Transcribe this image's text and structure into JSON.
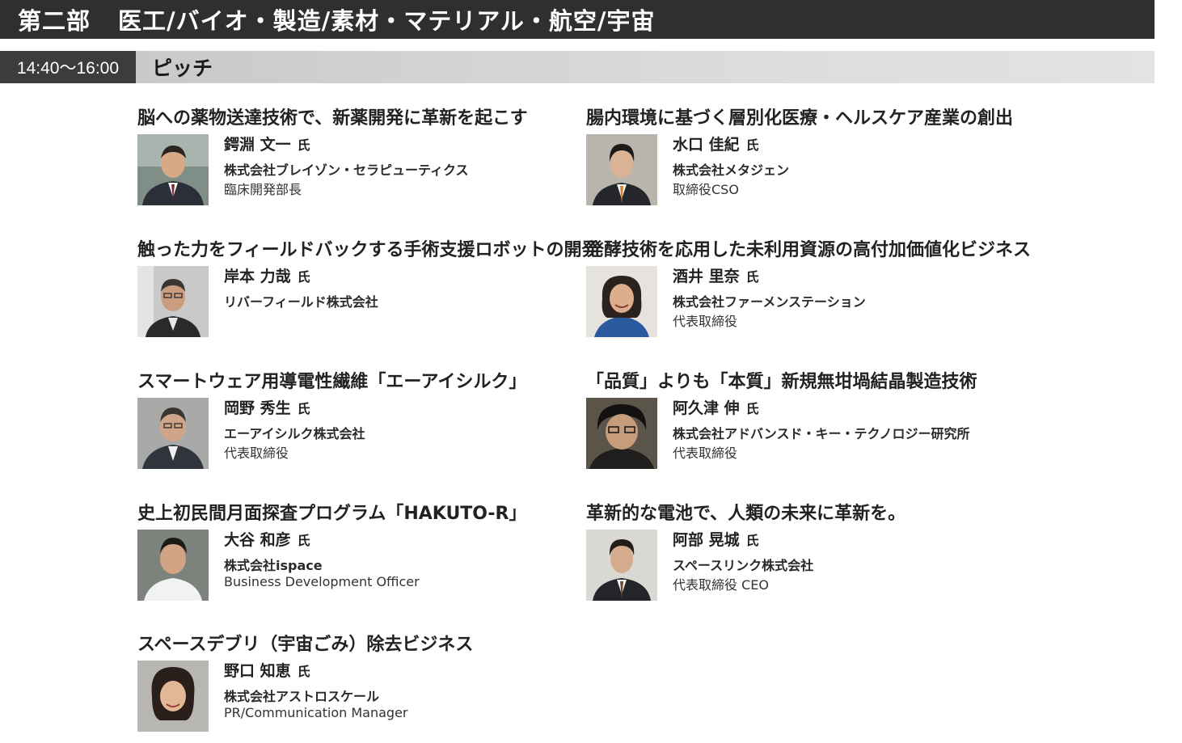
{
  "header": {
    "part": "第二部",
    "title": "医工/バイオ・製造/素材・マテリアル・航空/宇宙"
  },
  "session": {
    "time": "14:40〜16:00",
    "label": "ピッチ"
  },
  "honorific": "氏",
  "talks": [
    {
      "title": "脳への薬物送達技術で、新薬開発に革新を起こす",
      "speaker": "鍔淵 文一",
      "organization": "株式会社ブレイゾン・セラピューティクス",
      "role": "臨床開発部長"
    },
    {
      "title": "腸内環境に基づく層別化医療・ヘルスケア産業の創出",
      "speaker": "水口 佳紀",
      "organization": "株式会社メタジェン",
      "role": "取締役CSO"
    },
    {
      "title": "触った力をフィールドバックする手術支援ロボットの開発",
      "speaker": "岸本 力哉",
      "organization": "リバーフィールド株式会社",
      "role": ""
    },
    {
      "title": "発酵技術を応用した未利用資源の高付加価値化ビジネス",
      "speaker": "酒井 里奈",
      "organization": "株式会社ファーメンステーション",
      "role": "代表取締役"
    },
    {
      "title": "スマートウェア用導電性繊維「エーアイシルク」",
      "speaker": "岡野 秀生",
      "organization": "エーアイシルク株式会社",
      "role": "代表取締役"
    },
    {
      "title": "「品質」よりも「本質」新規無坩堝結晶製造技術",
      "speaker": "阿久津 伸",
      "organization": "株式会社アドバンスド・キー・テクノロジー研究所",
      "role": "代表取締役"
    },
    {
      "title": "史上初民間月面探査プログラム「HAKUTO-R」",
      "speaker": "大谷 和彦",
      "organization": "株式会社ispace",
      "role": "Business Development Officer"
    },
    {
      "title": "革新的な電池で、人類の未来に革新を。",
      "speaker": "阿部 晃城",
      "organization": "スペースリンク株式会社",
      "role": "代表取締役 CEO"
    },
    {
      "title": "スペースデブリ（宇宙ごみ）除去ビジネス",
      "speaker": "野口 知恵",
      "organization": "株式会社アストロスケール",
      "role": "PR/Communication Manager"
    }
  ],
  "colors": {
    "header_bg": "#2f2f2f",
    "session_time_bg": "#3c3c3c",
    "session_label_bg": "#d6d6d6"
  }
}
